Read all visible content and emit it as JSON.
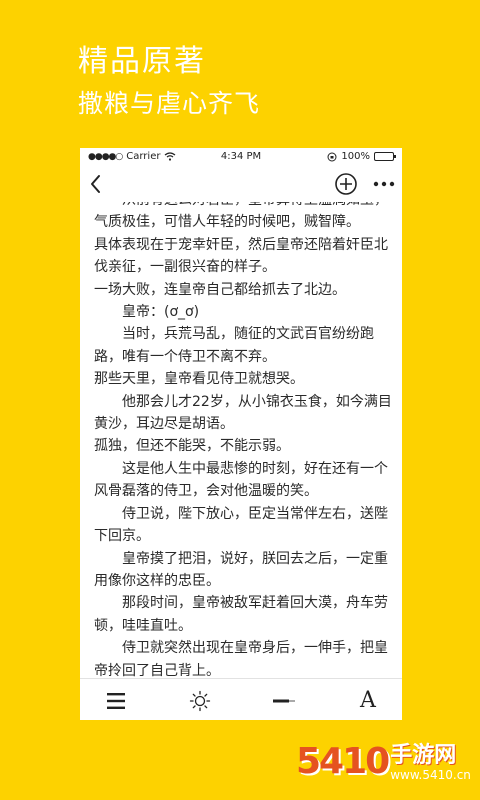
{
  "promo": {
    "title": "精品原著",
    "subtitle": "撒粮与虐心齐飞"
  },
  "status_bar": {
    "signal": "●●●●○",
    "carrier": "Carrier",
    "time": "4:34 PM",
    "battery": "100%"
  },
  "nav": {
    "back_icon": "back-chevron-icon",
    "add_icon": "add-circle-icon",
    "more_icon": "more-dots-icon"
  },
  "reader": {
    "paragraphs": [
      {
        "indent": true,
        "text": "从前有这么对君臣，皇帝算得上温润如玉，气质极佳，可惜人年轻的时候吧，贼智障。"
      },
      {
        "indent": false,
        "text": "具体表现在于宠幸奸臣，然后皇帝还陪着奸臣北伐亲征，一副很兴奋的样子。"
      },
      {
        "indent": false,
        "text": "一场大败，连皇帝自己都给抓去了北边。"
      },
      {
        "indent": true,
        "text": "皇帝：(ơ_ơ)"
      },
      {
        "indent": true,
        "text": "当时，兵荒马乱，随征的文武百官纷纷跑路，唯有一个侍卫不离不弃。"
      },
      {
        "indent": false,
        "text": "那些天里，皇帝看见侍卫就想哭。"
      },
      {
        "indent": true,
        "text": "他那会儿才22岁，从小锦衣玉食，如今满目黄沙，耳边尽是胡语。"
      },
      {
        "indent": false,
        "text": "孤独，但还不能哭，不能示弱。"
      },
      {
        "indent": true,
        "text": "这是他人生中最悲惨的时刻，好在还有一个风骨磊落的侍卫，会对他温暖的笑。"
      },
      {
        "indent": true,
        "text": "侍卫说，陛下放心，臣定当常伴左右，送陛下回京。"
      },
      {
        "indent": true,
        "text": "皇帝摸了把泪，说好，朕回去之后，一定重用像你这样的忠臣。"
      },
      {
        "indent": true,
        "text": "那段时间，皇帝被敌军赶着回大漠，舟车劳顿，哇哇直吐。"
      },
      {
        "indent": true,
        "text": "侍卫就突然出现在皇帝身后，一伸手，把皇帝拎回了自己背上。"
      }
    ]
  },
  "toolbar": {
    "menu_icon": "menu-icon",
    "brightness_icon": "brightness-icon",
    "slider_icon": "font-size-slider-icon",
    "font_label": "A"
  },
  "watermark": {
    "logo": "5410",
    "name": "手游网",
    "domain": "www.5410.cn"
  },
  "colors": {
    "background": "#fdd200",
    "text": "#2a2a2a",
    "watermark_accent": "#e55320"
  }
}
